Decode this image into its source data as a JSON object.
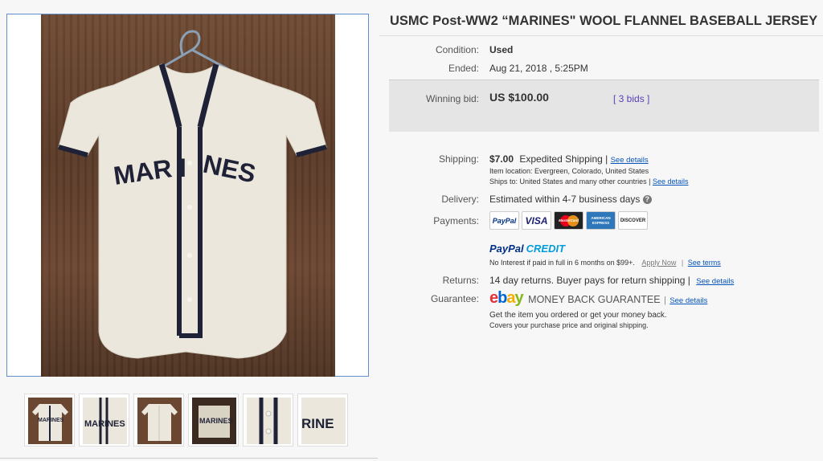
{
  "listing": {
    "title": "USMC Post-WW2 “MARINES\" WOOL FLANNEL BASEBALL JERSEY"
  },
  "photo": {
    "jersey_text": "MARINES",
    "thumb_texts": [
      "MARINES",
      "MARINES",
      "",
      "MARINES",
      "",
      "RINE"
    ]
  },
  "details": {
    "condition_label": "Condition:",
    "condition_value": "Used",
    "ended_label": "Ended:",
    "ended_value": "Aug 21, 2018 , 5:25PM",
    "winning_bid_label": "Winning bid:",
    "winning_bid_value": "US $100.00",
    "bids_link": "[ 3 bids ]"
  },
  "shipping": {
    "label": "Shipping:",
    "cost": "$7.00",
    "method": "Expedited Shipping |",
    "see_details": "See details",
    "item_location": "Item location:  Evergreen, Colorado, United States",
    "ships_to": "Ships to:  United States and many other countries |",
    "ships_see_details": "See details"
  },
  "delivery": {
    "label": "Delivery:",
    "value": "Estimated within 4-7 business days",
    "help_icon": "?"
  },
  "payments": {
    "label": "Payments:",
    "cards": [
      "PayPal",
      "VISA",
      "MasterCard",
      "AMERICAN EXPRESS",
      "DISCOVER"
    ],
    "paypal_credit_pay": "PayPal",
    "paypal_credit_word": "CREDIT",
    "credit_text": "No Interest if paid in full in 6 months on $99+.",
    "apply_now": "Apply Now",
    "see_terms": "See terms"
  },
  "returns": {
    "label": "Returns:",
    "value": "14 day returns. Buyer pays for return shipping |",
    "see_details": "See details"
  },
  "guarantee": {
    "label": "Guarantee:",
    "logo": "ebay",
    "title": "MONEY BACK GUARANTEE",
    "see_details": "See details",
    "line1": "Get the item you ordered or get your money back.",
    "line2": "Covers your purchase price and original shipping."
  },
  "colors": {
    "link": "#0654ba",
    "bid_link": "#5a3fb8",
    "paypal_dark": "#003087",
    "paypal_light": "#009cde"
  }
}
